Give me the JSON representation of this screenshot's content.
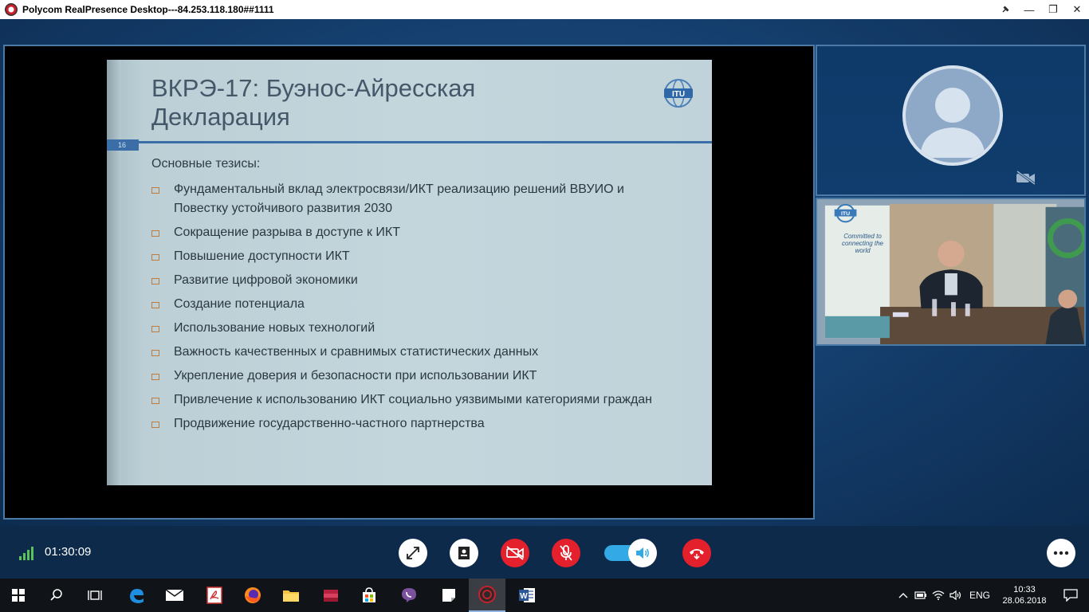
{
  "window": {
    "title": "Polycom RealPresence Desktop---84.253.118.180##1111",
    "minimize": "—",
    "restore": "❐",
    "close": "✕"
  },
  "slide": {
    "title_line1": "ВКРЭ-17: Буэнос-Айресская",
    "title_line2": "Декларация",
    "page_number": "16",
    "subtitle": "Основные тезисы:",
    "bullets": [
      "Фундаментальный вклад электросвязи/ИКТ реализацию решений ВВУИО и Повестку устойчивого развития 2030",
      "Сокращение разрыва в доступе к ИКТ",
      "Повышение доступности ИКТ",
      "Развитие цифровой экономики",
      "Создание потенциала",
      "Использование новых технологий",
      "Важность качественных и сравнимых статистических данных",
      "Укрепление доверия и безопасности при использовании ИКТ",
      "Привлечение к использованию ИКТ социально уязвимыми категориями граждан",
      "Продвижение государственно-частного партнерства"
    ]
  },
  "remote": {
    "banner_text": "Committed to connecting the world"
  },
  "call": {
    "duration": "01:30:09",
    "volume_on": true
  },
  "taskbar": {
    "language": "ENG",
    "time": "10:33",
    "date": "28.06.2018"
  },
  "colors": {
    "hangup": "#e4202c",
    "volume_track": "#33a9e6",
    "signal": "#5bc15b"
  }
}
